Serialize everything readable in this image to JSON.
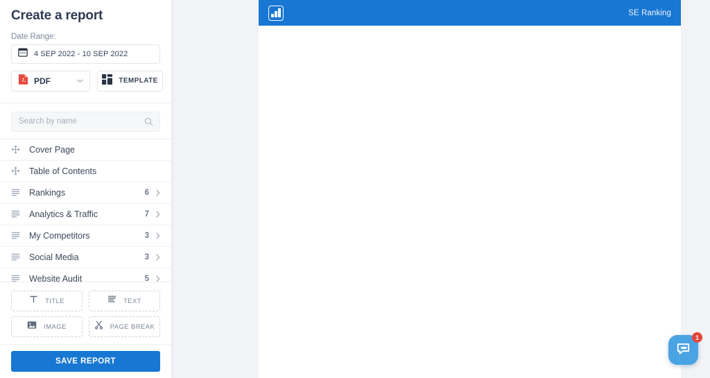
{
  "sidebar": {
    "title": "Create a report",
    "date_range_label": "Date Range:",
    "date_range_value": "4 SEP 2022 - 10 SEP 2022",
    "date_icon": "calendar-icon",
    "format_button": {
      "label": "PDF",
      "icon": "pdf-file-icon",
      "caret": "⌄"
    },
    "template_button": {
      "label": "TEMPLATE",
      "icon": "grid-layout-icon"
    },
    "search": {
      "placeholder": "Search by name",
      "value": "",
      "icon": "search-icon"
    },
    "items": [
      {
        "label": "Cover Page",
        "count": "",
        "icon": "drag-move-icon",
        "chevron": false
      },
      {
        "label": "Table of Contents",
        "count": "",
        "icon": "drag-move-icon",
        "chevron": false
      },
      {
        "label": "Rankings",
        "count": "6",
        "icon": "text-lines-icon",
        "chevron": true
      },
      {
        "label": "Analytics & Traffic",
        "count": "7",
        "icon": "text-lines-icon",
        "chevron": true
      },
      {
        "label": "My Competitors",
        "count": "3",
        "icon": "text-lines-icon",
        "chevron": true
      },
      {
        "label": "Social Media",
        "count": "3",
        "icon": "text-lines-icon",
        "chevron": true
      },
      {
        "label": "Website Audit",
        "count": "5",
        "icon": "text-lines-icon",
        "chevron": true
      }
    ],
    "tools": [
      {
        "label": "TITLE",
        "icon": "title-t-icon"
      },
      {
        "label": "TEXT",
        "icon": "text-align-icon"
      },
      {
        "label": "IMAGE",
        "icon": "image-icon"
      },
      {
        "label": "PAGE BREAK",
        "icon": "scissors-icon"
      }
    ],
    "save_label": "SAVE REPORT"
  },
  "document": {
    "brand_name": "SE Ranking",
    "logo_icon": "bar-chart-logo-icon",
    "header_color": "#1877d2"
  },
  "chat": {
    "icon": "chat-bubble-icon",
    "badge_count": "1",
    "badge_color": "#e8443a",
    "button_color": "#4aa3e2"
  },
  "theme": {
    "accent": "#1877d2",
    "page_background": "#f2f3f7",
    "title_color": "#2e3a52"
  }
}
